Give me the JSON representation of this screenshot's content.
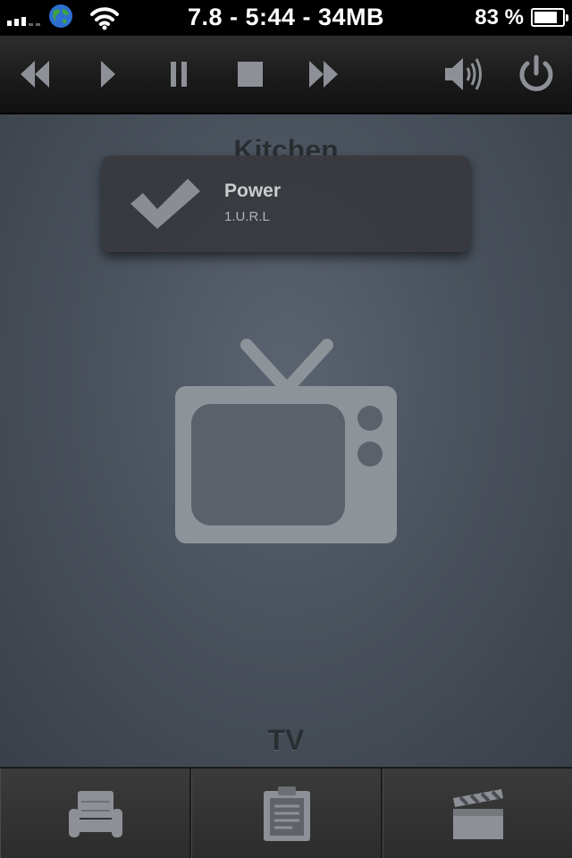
{
  "status_bar": {
    "center_text": "7.8 - 5:44 - 34MB",
    "battery_percent": "83 %",
    "battery_level": 0.83,
    "signal_bars_active": 3,
    "signal_bars_total": 5
  },
  "toolbar": {
    "buttons": [
      {
        "name": "rewind",
        "icon": "rewind-icon"
      },
      {
        "name": "play",
        "icon": "play-icon"
      },
      {
        "name": "pause",
        "icon": "pause-icon"
      },
      {
        "name": "stop",
        "icon": "stop-icon"
      },
      {
        "name": "fast-forward",
        "icon": "fast-forward-icon"
      },
      {
        "name": "volume",
        "icon": "volume-icon"
      },
      {
        "name": "power",
        "icon": "power-icon"
      }
    ]
  },
  "main": {
    "room_title": "Kitchen",
    "device_label": "TV",
    "device_icon": "tv-icon",
    "notification": {
      "title": "Power",
      "subtitle": "1.U.R.L",
      "icon": "checkmark-icon"
    }
  },
  "tab_bar": {
    "tabs": [
      {
        "name": "rooms",
        "icon": "armchair-icon"
      },
      {
        "name": "activities",
        "icon": "clipboard-icon"
      },
      {
        "name": "media",
        "icon": "clapperboard-icon"
      }
    ]
  },
  "colors": {
    "background": "#4a525d",
    "toolbar": "#1f1f1f",
    "icon_gray": "#8d9096",
    "popup": "#383a3e",
    "title_text": "#2a2d31"
  }
}
